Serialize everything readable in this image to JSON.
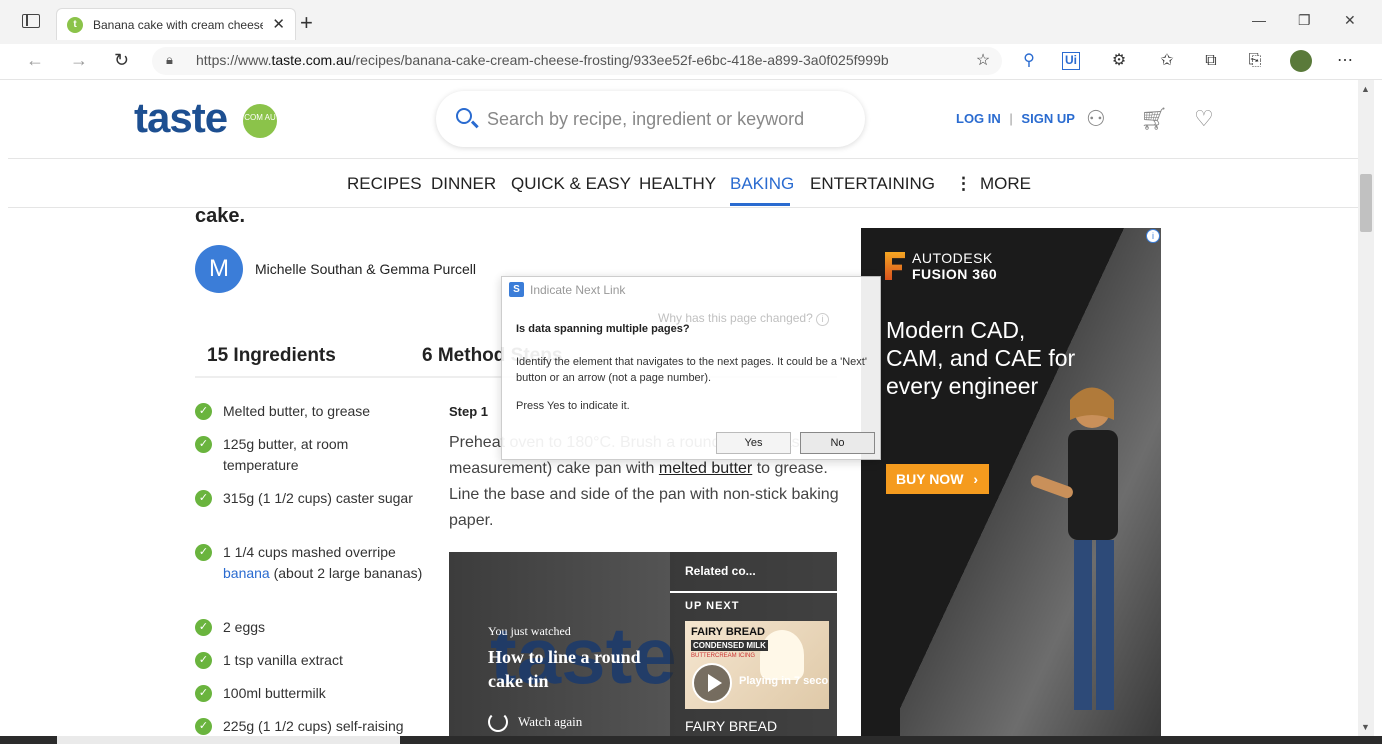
{
  "browser": {
    "tab_title": "Banana cake with cream cheese f",
    "tab_favicon_letter": "t",
    "url_prefix": "https://www.",
    "url_domain": "taste.com.au",
    "url_path": "/recipes/banana-cake-cream-cheese-frosting/933ee52f-e6bc-418e-a899-3a0f025f999b",
    "new_tab": "+",
    "close_tab": "✕"
  },
  "site": {
    "logo_text": "taste",
    "logo_badge": "COM AU",
    "search_placeholder": "Search by recipe, ingredient or keyword",
    "login": "LOG IN",
    "separator": "|",
    "signup": "SIGN UP"
  },
  "nav": {
    "items": [
      "RECIPES",
      "DINNER",
      "QUICK & EASY",
      "HEALTHY",
      "BAKING",
      "ENTERTAINING",
      "MORE"
    ],
    "active": "BAKING"
  },
  "recipe": {
    "title_fragment": "cake.",
    "avatar_letter": "M",
    "author": "Michelle Southan & Gemma Purcell",
    "tab_ingredients": "15 Ingredients",
    "tab_method": "6 Method Steps",
    "ingredients": [
      {
        "text": "Melted butter, to grease"
      },
      {
        "text": "125g butter, at room temperature"
      },
      {
        "text": "315g (1 1/2 cups) caster sugar"
      },
      {
        "text_before": "1 1/4 cups mashed overripe ",
        "link": "banana",
        "text_after": " (about 2 large bananas)"
      },
      {
        "text": "2 eggs"
      },
      {
        "text": "1 tsp vanilla extract"
      },
      {
        "text": "100ml buttermilk"
      },
      {
        "text": "225g (1 1/2 cups) self-raising"
      }
    ],
    "step_label": "Step 1",
    "step_text_a": "Preheat oven to 180°C. Brush a round 21cm (base measurement) cake pan with ",
    "step_link": "melted butter",
    "step_text_b": " to grease. Line the base and side of the pan with non-stick baking paper."
  },
  "video": {
    "logo": "taste",
    "you_just_watched": "You just watched",
    "title": "How to line a round cake tin",
    "watch_again": "Watch again",
    "related": "Related co...",
    "up_next": "UP NEXT",
    "thumb_title": "FAIRY BREAD",
    "thumb_sub": "CONDENSED MILK",
    "thumb_sub2": "BUTTERCREAM ICING",
    "playing": "Playing in 7 seconds",
    "next_title": "FAIRY BREAD"
  },
  "ad": {
    "brand_line1": "AUTODESK",
    "brand_line2": "FUSION 360",
    "headline": "Modern CAD, CAM, and CAE for every engineer",
    "cta": "BUY NOW",
    "cta_arrow": "›",
    "info": "i"
  },
  "dialog": {
    "title": "Indicate Next Link",
    "why": "Why has this page changed?",
    "question": "Is data spanning multiple pages?",
    "description": "Identify the element that navigates to the next pages. It could be a 'Next' button or an arrow (not a page number).",
    "press": "Press Yes to indicate it.",
    "yes": "Yes",
    "no": "No"
  },
  "colors": {
    "brand_blue": "#1d4f91",
    "link_blue": "#2a6bd0",
    "check_green": "#6ab43e",
    "ad_orange": "#f59b1e"
  }
}
